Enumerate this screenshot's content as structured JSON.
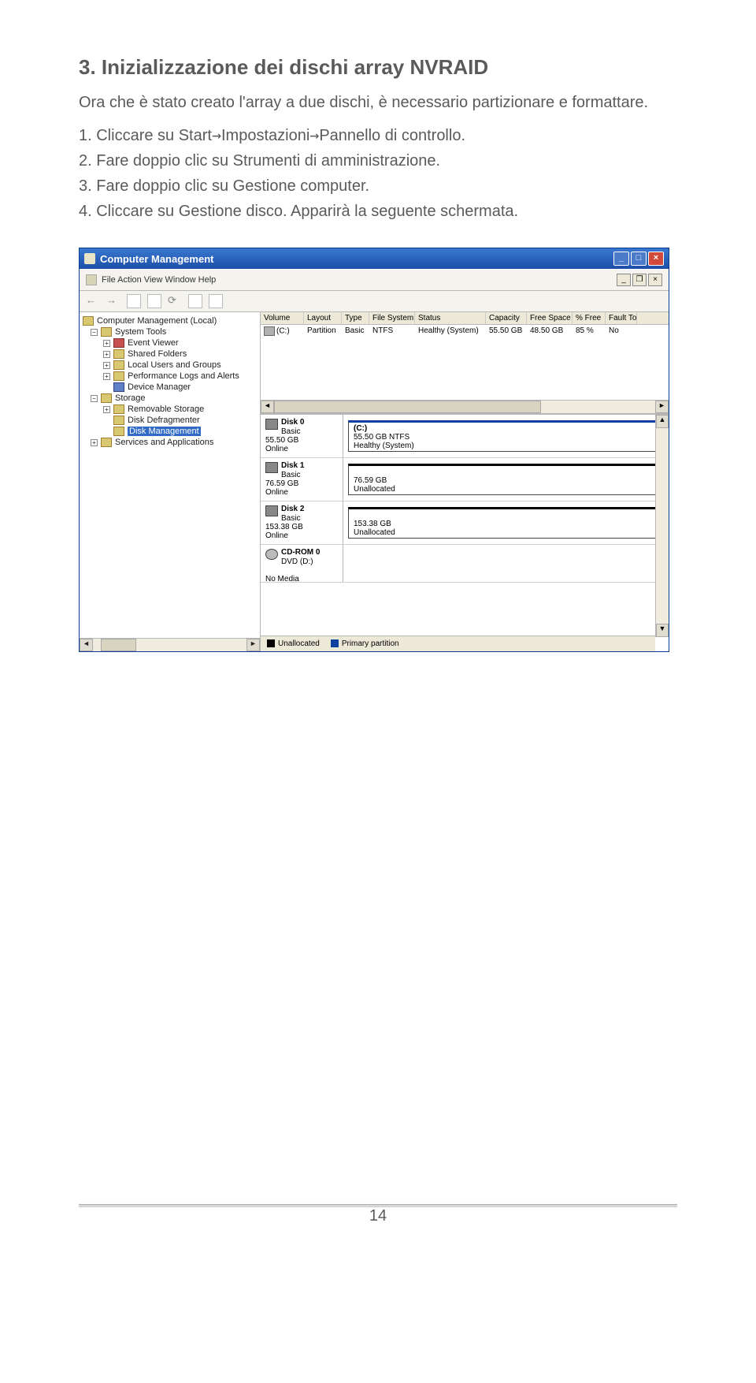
{
  "heading": "3. Inizializzazione dei dischi array NVRAID",
  "intro": "Ora che è stato creato l'array a due dischi, è necessario partizionare e formattare.",
  "steps": {
    "s1_prefix": "1. Cliccare su Start",
    "s1_a": "Impostazioni",
    "s1_b": "Pannello di controllo.",
    "s2": "2. Fare doppio clic su Strumenti di amministrazione.",
    "s3": "3. Fare doppio clic su Gestione computer.",
    "s4": "4. Cliccare su Gestione disco. Apparirà la seguente schermata."
  },
  "arrow": "→",
  "win": {
    "title": "Computer Management",
    "menu": "File   Action   View   Window   Help",
    "min": "_",
    "max": "□",
    "close": "×",
    "docmin": "_",
    "docrestore": "❐",
    "docclose": "×",
    "tree": {
      "root": "Computer Management (Local)",
      "sys": "System Tools",
      "ev": "Event Viewer",
      "sf": "Shared Folders",
      "lu": "Local Users and Groups",
      "pl": "Performance Logs and Alerts",
      "dm": "Device Manager",
      "storage": "Storage",
      "rs": "Removable Storage",
      "dd": "Disk Defragmenter",
      "dsk": "Disk Management",
      "sa": "Services and Applications"
    },
    "cols": {
      "vol": "Volume",
      "lay": "Layout",
      "typ": "Type",
      "fs": "File System",
      "st": "Status",
      "cap": "Capacity",
      "fr": "Free Space",
      "pf": "% Free",
      "ft": "Fault To"
    },
    "vol": {
      "name": "(C:)",
      "lay": "Partition",
      "typ": "Basic",
      "fs": "NTFS",
      "st": "Healthy (System)",
      "cap": "55.50 GB",
      "fr": "48.50 GB",
      "pf": "85 %",
      "ft": "No"
    },
    "d0": {
      "name": "Disk 0",
      "type": "Basic",
      "size": "55.50 GB",
      "state": "Online",
      "pname": "(C:)",
      "pinfo": "55.50 GB NTFS",
      "pstat": "Healthy (System)"
    },
    "d1": {
      "name": "Disk 1",
      "type": "Basic",
      "size": "76.59 GB",
      "state": "Online",
      "psize": "76.59 GB",
      "pstat": "Unallocated"
    },
    "d2": {
      "name": "Disk 2",
      "type": "Basic",
      "size": "153.38 GB",
      "state": "Online",
      "psize": "153.38 GB",
      "pstat": "Unallocated"
    },
    "cd": {
      "name": "CD-ROM 0",
      "type": "DVD (D:)",
      "state": "No Media"
    },
    "legend": {
      "un": "Unallocated",
      "pp": "Primary partition"
    }
  },
  "page": "14"
}
